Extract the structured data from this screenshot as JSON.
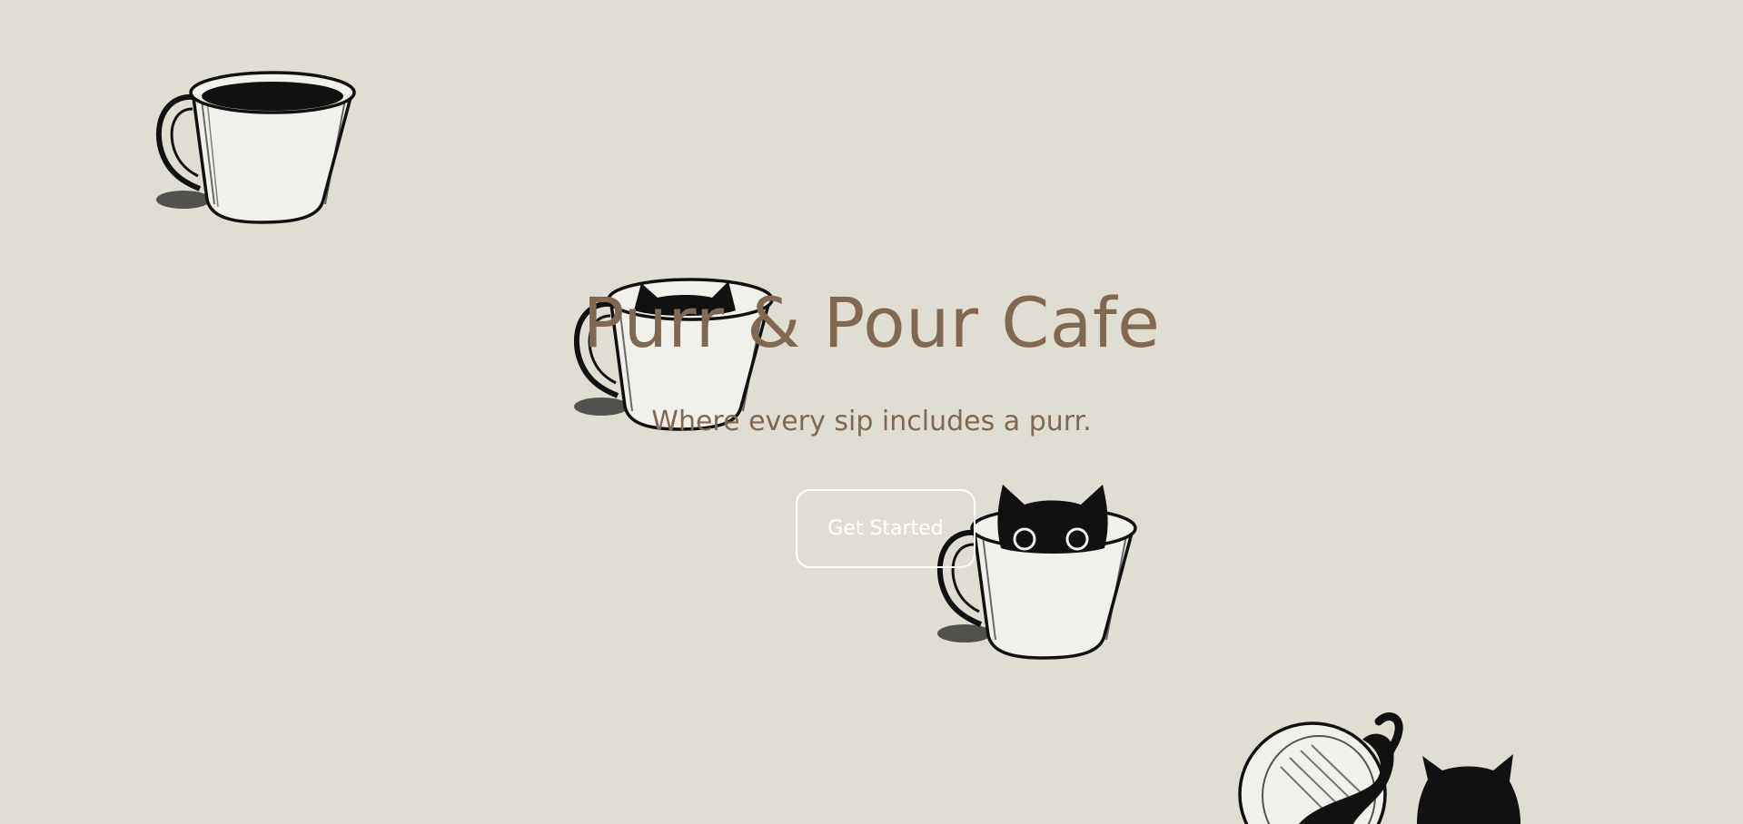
{
  "hero": {
    "title": "Purr & Pour Cafe",
    "subtitle": "Where every sip includes a purr.",
    "cta_label": "Get Started"
  },
  "colors": {
    "background": "#e0ded3",
    "text": "#806852",
    "button_border": "#ffffff",
    "ink": "#111111"
  },
  "illustrations": [
    "coffee-cup-icon",
    "cat-in-cup-icon",
    "peeking-cat-cup-icon",
    "tipped-cup-cats-icon"
  ]
}
